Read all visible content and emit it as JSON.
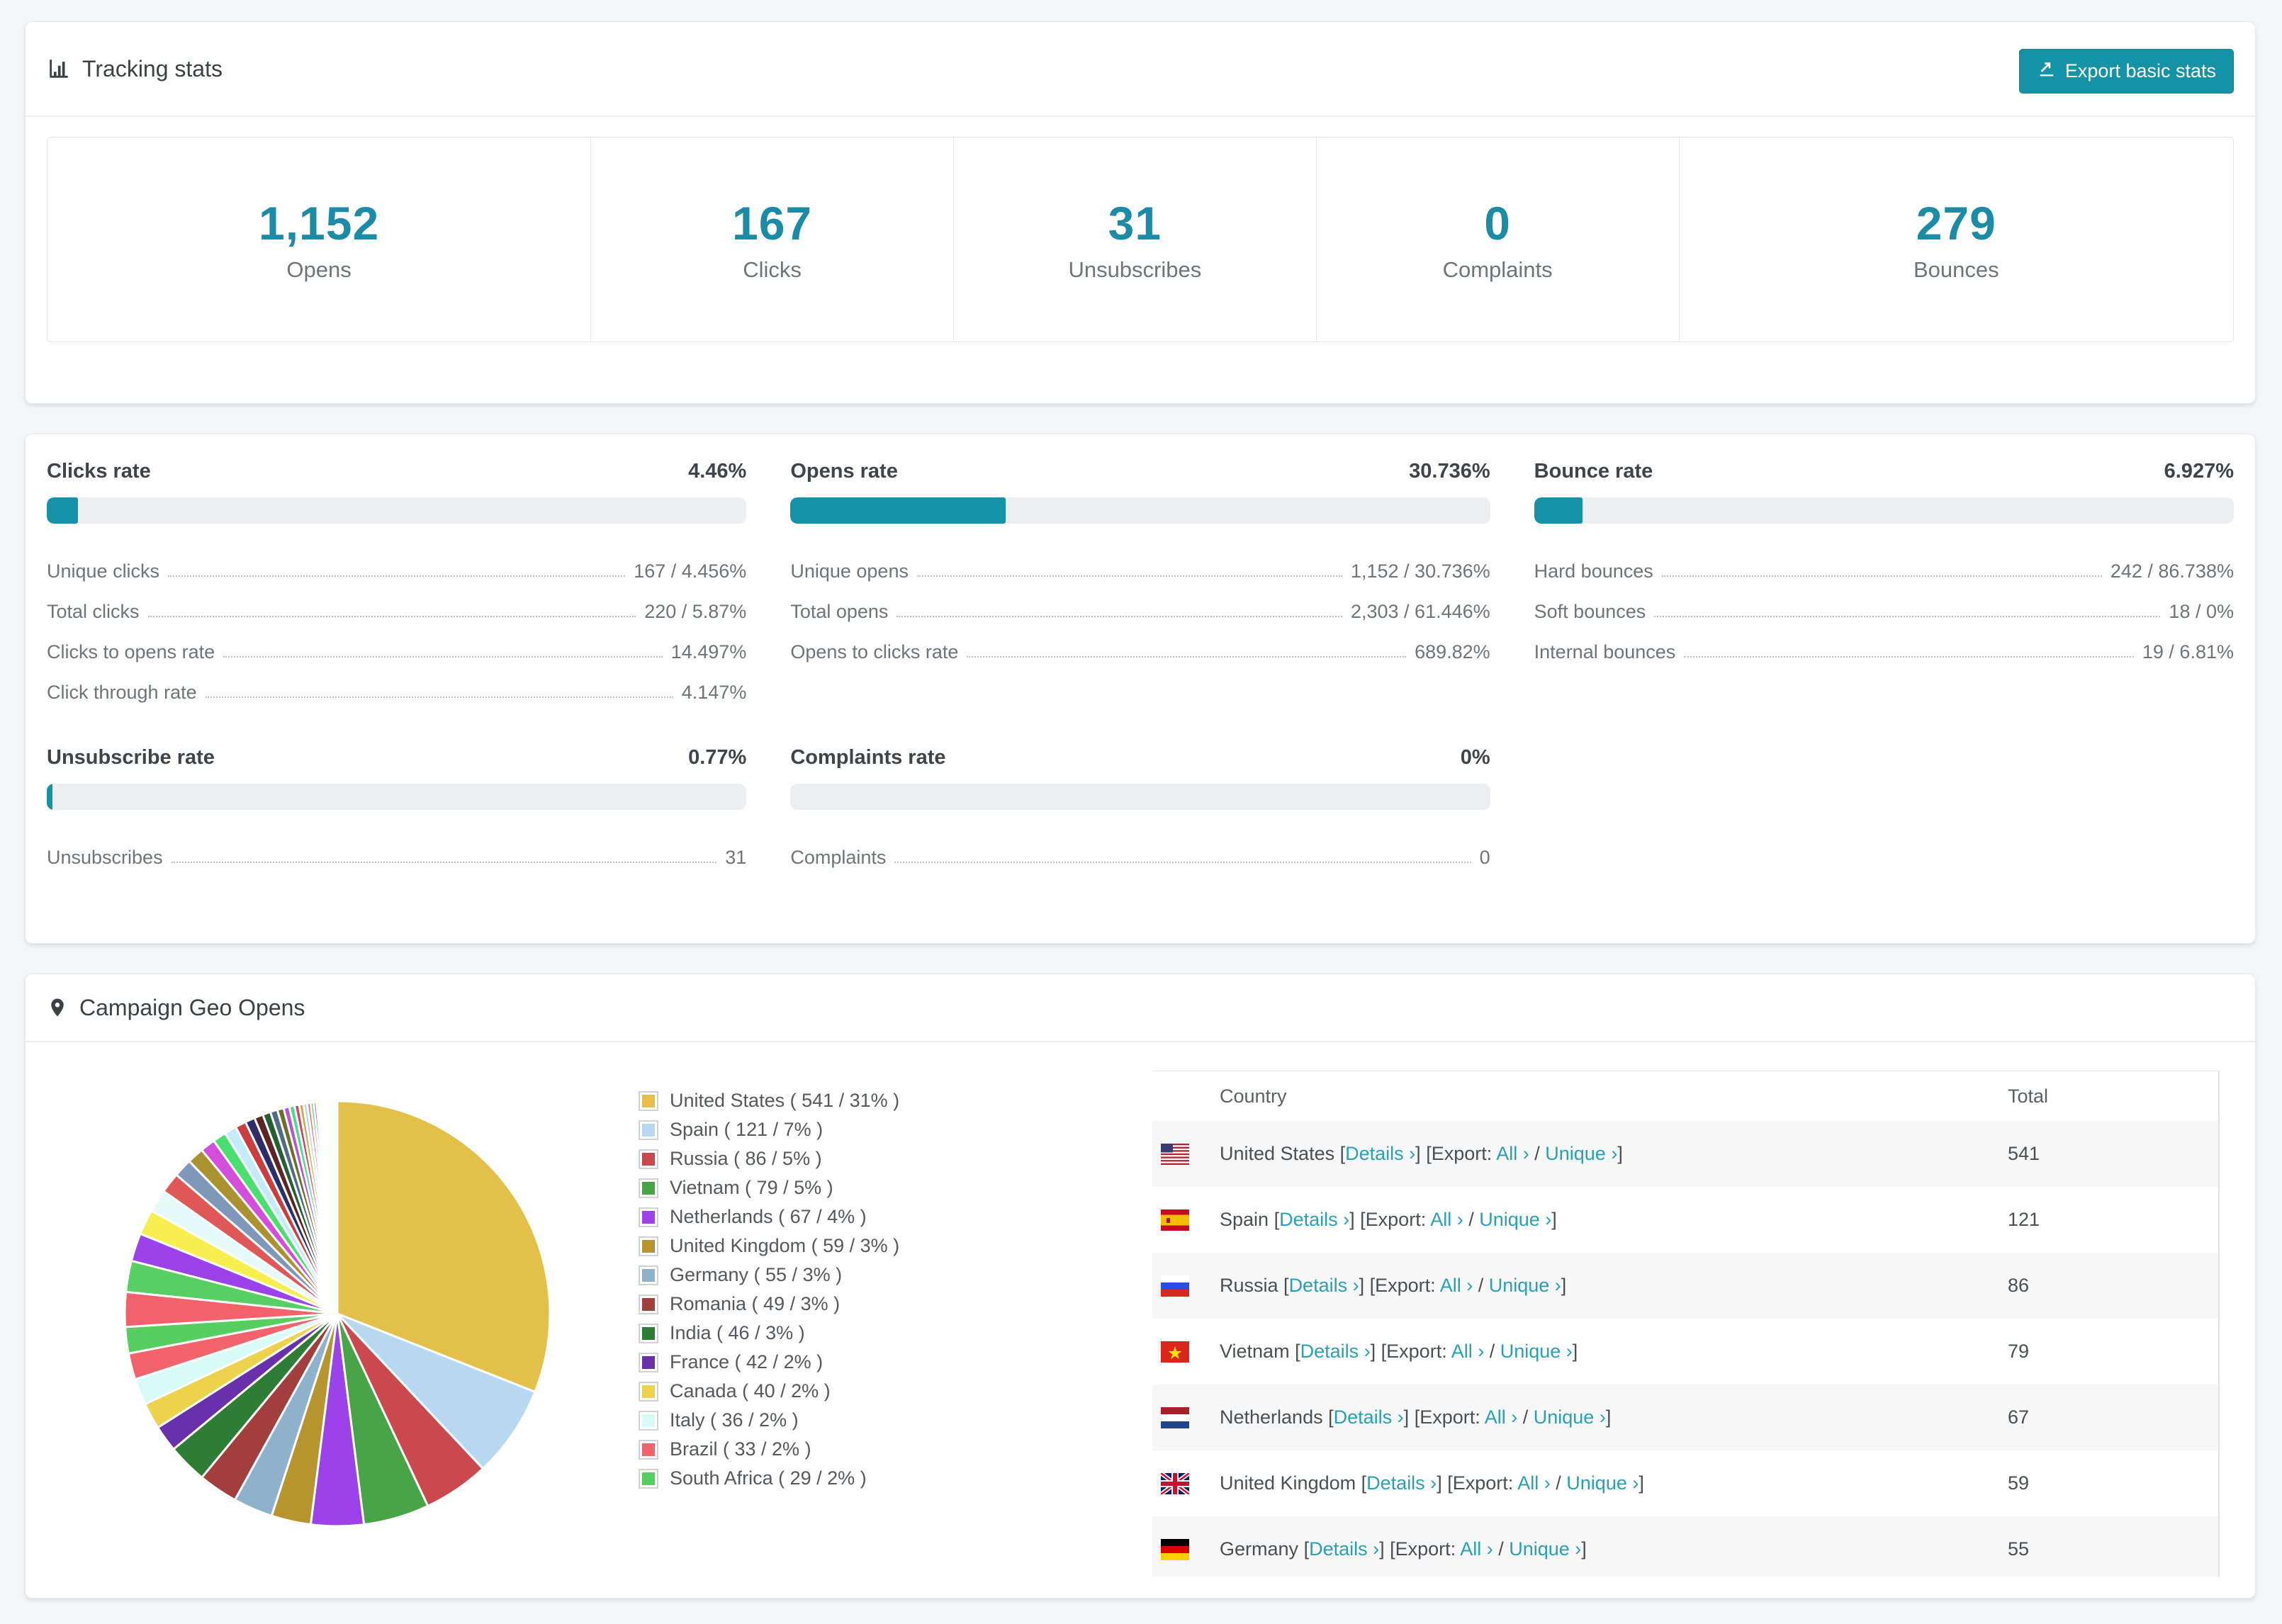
{
  "colors": {
    "accent": "#1692a7",
    "stat_number": "#1b8ba6",
    "link": "#28a0b6",
    "bar_track": "#eceef1"
  },
  "tracking": {
    "title": "Tracking stats",
    "export_button_label": "Export basic stats",
    "stats": [
      {
        "value": "1,152",
        "label": "Opens"
      },
      {
        "value": "167",
        "label": "Clicks"
      },
      {
        "value": "31",
        "label": "Unsubscribes"
      },
      {
        "value": "0",
        "label": "Complaints"
      },
      {
        "value": "279",
        "label": "Bounces"
      }
    ]
  },
  "rates": {
    "sections": [
      {
        "title": "Clicks rate",
        "value": "4.46%",
        "percent": 4.46,
        "rows": [
          {
            "label": "Unique clicks",
            "value": "167 / 4.456%"
          },
          {
            "label": "Total clicks",
            "value": "220 / 5.87%"
          },
          {
            "label": "Clicks to opens rate",
            "value": "14.497%"
          },
          {
            "label": "Click through rate",
            "value": "4.147%"
          }
        ]
      },
      {
        "title": "Opens rate",
        "value": "30.736%",
        "percent": 30.736,
        "rows": [
          {
            "label": "Unique opens",
            "value": "1,152 / 30.736%"
          },
          {
            "label": "Total opens",
            "value": "2,303 / 61.446%"
          },
          {
            "label": "Opens to clicks rate",
            "value": "689.82%"
          }
        ]
      },
      {
        "title": "Bounce rate",
        "value": "6.927%",
        "percent": 6.927,
        "rows": [
          {
            "label": "Hard bounces",
            "value": "242 / 86.738%"
          },
          {
            "label": "Soft bounces",
            "value": "18 / 0%"
          },
          {
            "label": "Internal bounces",
            "value": "19 / 6.81%"
          }
        ]
      },
      {
        "title": "Unsubscribe rate",
        "value": "0.77%",
        "percent": 0.77,
        "rows": [
          {
            "label": "Unsubscribes",
            "value": "31"
          }
        ]
      },
      {
        "title": "Complaints rate",
        "value": "0%",
        "percent": 0,
        "rows": [
          {
            "label": "Complaints",
            "value": "0"
          }
        ]
      }
    ]
  },
  "geo": {
    "title": "Campaign Geo Opens",
    "chart_data": {
      "type": "pie",
      "title": "Campaign Geo Opens",
      "legend_position": "right",
      "start_angle_deg": 0,
      "direction": "clockwise",
      "slices": [
        {
          "label": "United States",
          "value": 541,
          "percent": 31,
          "color": "#e3c04a"
        },
        {
          "label": "Spain",
          "value": 121,
          "percent": 7,
          "color": "#b8d8f0"
        },
        {
          "label": "Russia",
          "value": 86,
          "percent": 5,
          "color": "#c9494e"
        },
        {
          "label": "Vietnam",
          "value": 79,
          "percent": 5,
          "color": "#47a447"
        },
        {
          "label": "Netherlands",
          "value": 67,
          "percent": 4,
          "color": "#9b42ea"
        },
        {
          "label": "United Kingdom",
          "value": 59,
          "percent": 3,
          "color": "#b6952f"
        },
        {
          "label": "Germany",
          "value": 55,
          "percent": 3,
          "color": "#8fb2cc"
        },
        {
          "label": "Romania",
          "value": 49,
          "percent": 3,
          "color": "#a33e3e"
        },
        {
          "label": "India",
          "value": 46,
          "percent": 3,
          "color": "#2e7d36"
        },
        {
          "label": "France",
          "value": 42,
          "percent": 2,
          "color": "#6930ab"
        },
        {
          "label": "Canada",
          "value": 40,
          "percent": 2,
          "color": "#edd24e"
        },
        {
          "label": "Italy",
          "value": 36,
          "percent": 2,
          "color": "#d8fbf8"
        },
        {
          "label": "Brazil",
          "value": 33,
          "percent": 2,
          "color": "#f2636b"
        },
        {
          "label": "South Africa",
          "value": 29,
          "percent": 2,
          "color": "#56cf60"
        }
      ],
      "others_percent": 26,
      "others_slice_count": 42
    },
    "table": {
      "headers": {
        "country": "Country",
        "total": "Total"
      },
      "links": {
        "details": "Details",
        "export_prefix": "Export:",
        "all": "All",
        "unique": "Unique",
        "arrow": "›"
      },
      "rows": [
        {
          "country": "United States",
          "flag": "us",
          "total": "541"
        },
        {
          "country": "Spain",
          "flag": "es",
          "total": "121"
        },
        {
          "country": "Russia",
          "flag": "ru",
          "total": "86"
        },
        {
          "country": "Vietnam",
          "flag": "vn",
          "total": "79"
        },
        {
          "country": "Netherlands",
          "flag": "nl",
          "total": "67"
        },
        {
          "country": "United Kingdom",
          "flag": "gb",
          "total": "59"
        },
        {
          "country": "Germany",
          "flag": "de",
          "total": "55"
        }
      ]
    }
  }
}
